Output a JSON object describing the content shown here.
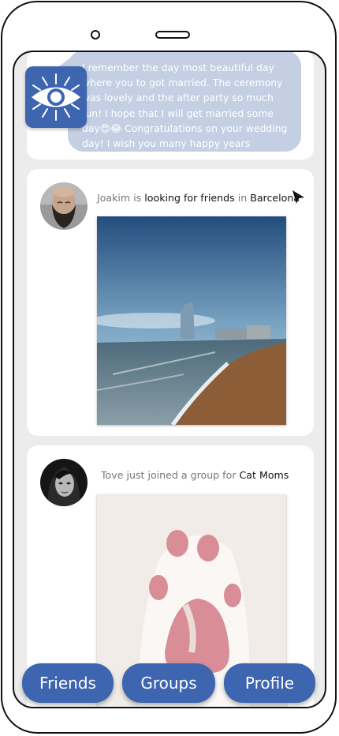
{
  "message": {
    "text": "I remember the day most beautiful day where you to got married. The ceremony was lovely and the after party so much fun! I hope that I will get married some day😍😂 Congratulations on your wedding day! I wish you many happy years together ❤️"
  },
  "posts": [
    {
      "user": "Joakim",
      "verb1": " is ",
      "activity": "looking for friends",
      "verb2": " in ",
      "place": "Barcelona"
    },
    {
      "user": "Tove",
      "verb1": " just joined a group for ",
      "place": "Cat Moms"
    }
  ],
  "nav": {
    "friends": "Friends",
    "groups": "Groups",
    "profile": "Profile"
  },
  "colors": {
    "accent": "#3e65b0",
    "bubble": "#c4cfe4",
    "screen_bg": "#ececec"
  },
  "icons": {
    "logo": "eye-icon",
    "cursor": "mouse-pointer-icon"
  }
}
